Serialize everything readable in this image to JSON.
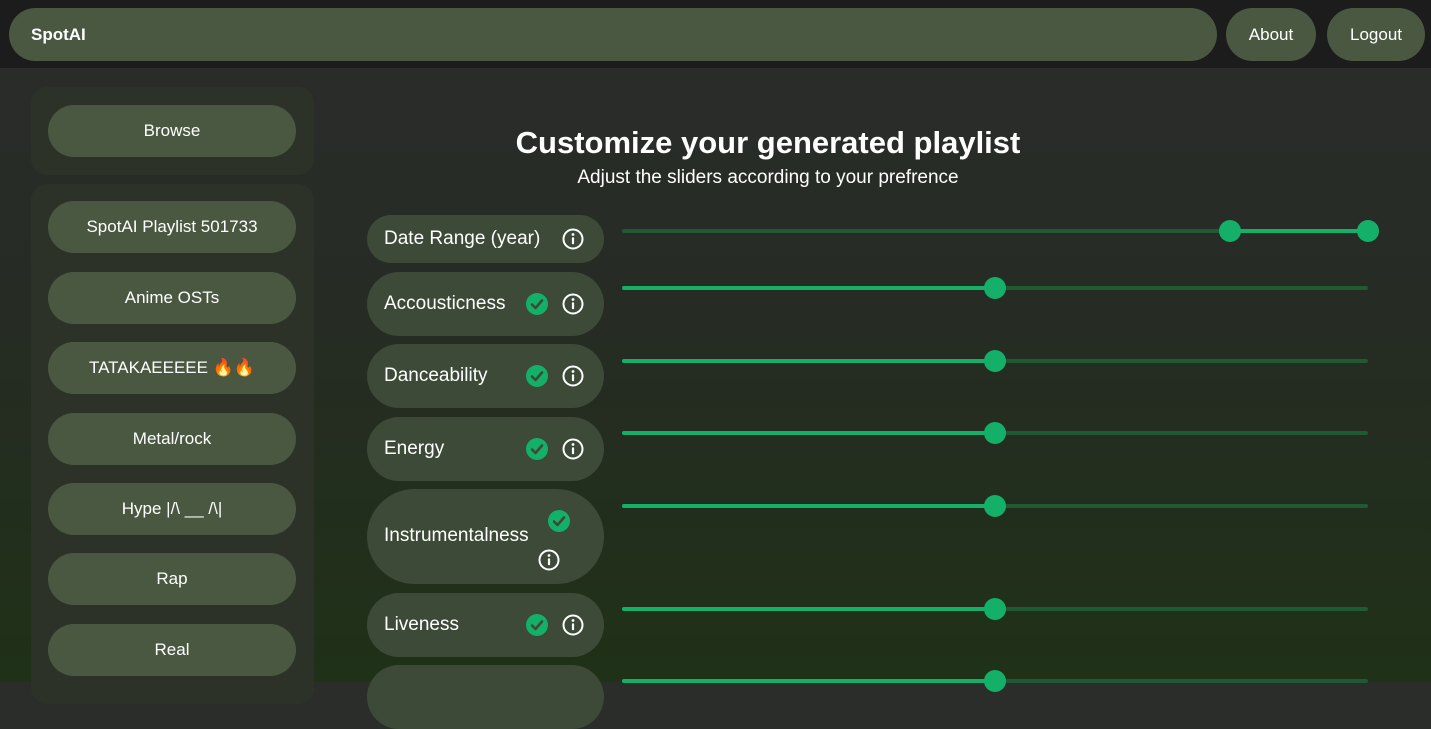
{
  "header": {
    "brand": "SpotAI",
    "about_label": "About",
    "logout_label": "Logout"
  },
  "sidebar": {
    "browse_label": "Browse",
    "playlists": [
      "SpotAI Playlist 501733",
      "Anime OSTs",
      "TATAKAEEEEE 🔥🔥",
      "Metal/rock",
      "Hype |/\\ __ /\\|",
      "Rap",
      "Real"
    ]
  },
  "main": {
    "title": "Customize your generated playlist",
    "subtitle": "Adjust the sliders according to your prefrence"
  },
  "sliders": [
    {
      "label": "Date Range (year)",
      "enabled": false,
      "range": [
        0.815,
        1.0
      ]
    },
    {
      "label": "Accousticness",
      "enabled": true,
      "value": 0.5
    },
    {
      "label": "Danceability",
      "enabled": true,
      "value": 0.5
    },
    {
      "label": "Energy",
      "enabled": true,
      "value": 0.5
    },
    {
      "label": "Instrumentalness",
      "enabled": true,
      "value": 0.5
    },
    {
      "label": "Liveness",
      "enabled": true,
      "value": 0.5
    },
    {
      "label": "",
      "enabled": true,
      "value": 0.5
    }
  ],
  "colors": {
    "accent": "#14b06a",
    "pill": "#4a5842"
  },
  "icons": {
    "check": "check-circle-icon",
    "info": "info-icon"
  }
}
